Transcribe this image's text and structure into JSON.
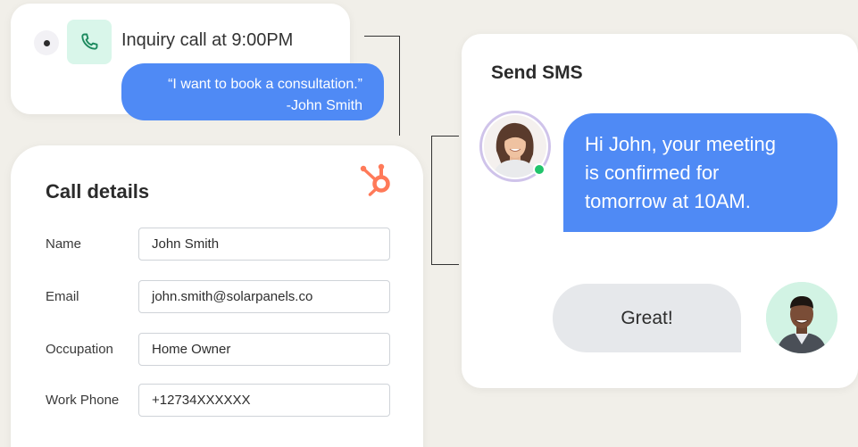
{
  "call_log": {
    "title": "Inquiry call at 9:00PM",
    "quote_line1": "“I want to book a consultation.”",
    "quote_line2": "-John Smith"
  },
  "call_details": {
    "title": "Call details",
    "fields": [
      {
        "label": "Name",
        "value": "John Smith"
      },
      {
        "label": "Email",
        "value": "john.smith@solarpanels.co"
      },
      {
        "label": "Occupation",
        "value": "Home Owner"
      },
      {
        "label": "Work Phone",
        "value": "+12734XXXXXX"
      }
    ]
  },
  "sms": {
    "title": "Send SMS",
    "message_line1": "Hi John, your meeting",
    "message_line2": "is confirmed for",
    "message_line3": "tomorrow at 10AM.",
    "reply": "Great!"
  },
  "icons": {
    "phone": "phone-icon",
    "brand": "hubspot-logo-icon",
    "status_dot": "online-status-icon"
  },
  "colors": {
    "accent_blue": "#4f8af5",
    "phone_bg": "#d9f6ea",
    "brand_orange": "#ff7a59",
    "online_green": "#21c46b",
    "reply_bg": "#e6e8eb",
    "background": "#f1efe9"
  }
}
